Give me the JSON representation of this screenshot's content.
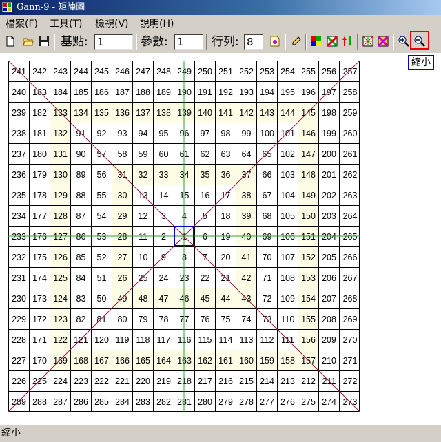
{
  "window": {
    "title": "Gann-9 - 矩陣圖"
  },
  "menu": [
    {
      "label": "檔案(F)"
    },
    {
      "label": "工具(T)"
    },
    {
      "label": "檢視(V)"
    },
    {
      "label": "說明(H)"
    }
  ],
  "toolbar": {
    "base_label": "基點:",
    "base_value": "1",
    "param_label": "參數:",
    "param_value": "1",
    "rows_label": "行列:",
    "rows_value": "8"
  },
  "tooltip": "縮小",
  "status": "縮小",
  "colors": {
    "highlight_red": "#e00000",
    "highlight_blue": "#0000cc",
    "diagonal": "#a02040",
    "cross": "#30a030",
    "shade": "#fdfde6"
  },
  "grid": {
    "size": 17,
    "rows": [
      [
        241,
        242,
        243,
        244,
        245,
        246,
        247,
        248,
        249,
        250,
        251,
        252,
        253,
        254,
        255,
        256,
        257
      ],
      [
        240,
        183,
        184,
        185,
        186,
        187,
        188,
        189,
        190,
        191,
        192,
        193,
        194,
        195,
        196,
        197,
        258
      ],
      [
        239,
        182,
        133,
        134,
        135,
        136,
        137,
        138,
        139,
        140,
        141,
        142,
        143,
        144,
        145,
        198,
        259
      ],
      [
        238,
        181,
        132,
        91,
        92,
        93,
        94,
        95,
        96,
        97,
        98,
        99,
        100,
        101,
        146,
        199,
        260
      ],
      [
        237,
        180,
        131,
        90,
        57,
        58,
        59,
        60,
        61,
        62,
        63,
        64,
        65,
        102,
        147,
        200,
        261
      ],
      [
        236,
        179,
        130,
        89,
        56,
        31,
        32,
        33,
        34,
        35,
        36,
        37,
        66,
        103,
        148,
        201,
        262
      ],
      [
        235,
        178,
        129,
        88,
        55,
        30,
        13,
        14,
        15,
        16,
        17,
        38,
        67,
        104,
        149,
        202,
        263
      ],
      [
        234,
        177,
        128,
        87,
        54,
        29,
        12,
        3,
        4,
        5,
        18,
        39,
        68,
        105,
        150,
        203,
        264
      ],
      [
        233,
        176,
        127,
        86,
        53,
        28,
        11,
        2,
        1,
        6,
        19,
        40,
        69,
        106,
        151,
        204,
        265
      ],
      [
        232,
        175,
        126,
        85,
        52,
        27,
        10,
        9,
        8,
        7,
        20,
        41,
        70,
        107,
        152,
        205,
        266
      ],
      [
        231,
        174,
        125,
        84,
        51,
        26,
        25,
        24,
        23,
        22,
        21,
        42,
        71,
        108,
        153,
        206,
        267
      ],
      [
        230,
        173,
        124,
        83,
        50,
        49,
        48,
        47,
        46,
        45,
        44,
        43,
        72,
        109,
        154,
        207,
        268
      ],
      [
        229,
        172,
        123,
        82,
        81,
        80,
        79,
        78,
        77,
        76,
        75,
        74,
        73,
        110,
        155,
        208,
        269
      ],
      [
        228,
        171,
        122,
        121,
        120,
        119,
        118,
        117,
        116,
        115,
        114,
        113,
        112,
        111,
        156,
        209,
        270
      ],
      [
        227,
        170,
        169,
        168,
        167,
        166,
        165,
        164,
        163,
        162,
        161,
        160,
        159,
        158,
        157,
        210,
        271
      ],
      [
        226,
        225,
        224,
        223,
        222,
        221,
        220,
        219,
        218,
        217,
        216,
        215,
        214,
        213,
        212,
        211,
        272
      ],
      [
        289,
        288,
        287,
        286,
        285,
        284,
        283,
        282,
        281,
        280,
        279,
        278,
        277,
        276,
        275,
        274,
        273
      ]
    ]
  }
}
